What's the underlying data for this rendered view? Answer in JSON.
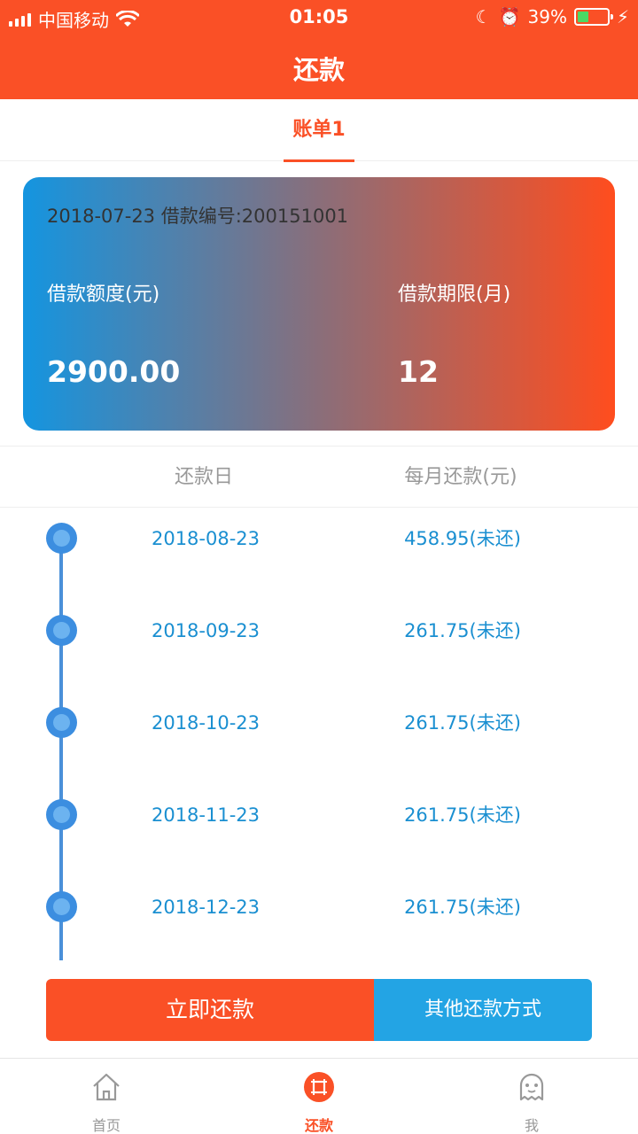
{
  "status_bar": {
    "carrier": "中国移动",
    "time": "01:05",
    "battery": "39%",
    "battery_level": 0.39
  },
  "header": {
    "title": "还款"
  },
  "tabs": [
    {
      "label": "账单1",
      "active": true
    }
  ],
  "loan_card": {
    "meta": "2018-07-23 借款编号:200151001",
    "amount_label": "借款额度(元)",
    "amount_value": "2900.00",
    "term_label": "借款期限(月)",
    "term_value": "12"
  },
  "schedule": {
    "col_date": "还款日",
    "col_amount": "每月还款(元)",
    "rows": [
      {
        "date": "2018-08-23",
        "amount": "458.95(未还)"
      },
      {
        "date": "2018-09-23",
        "amount": "261.75(未还)"
      },
      {
        "date": "2018-10-23",
        "amount": "261.75(未还)"
      },
      {
        "date": "2018-11-23",
        "amount": "261.75(未还)"
      },
      {
        "date": "2018-12-23",
        "amount": "261.75(未还)"
      }
    ]
  },
  "actions": {
    "pay_now": "立即还款",
    "other_methods": "其他还款方式"
  },
  "bottom_nav": [
    {
      "label": "首页",
      "icon": "home-icon"
    },
    {
      "label": "还款",
      "icon": "repay-icon",
      "active": true
    },
    {
      "label": "我",
      "icon": "profile-icon"
    }
  ],
  "colors": {
    "brand": "#fa5026",
    "accent_blue": "#23a4e4",
    "timeline": "#4a90d9"
  }
}
